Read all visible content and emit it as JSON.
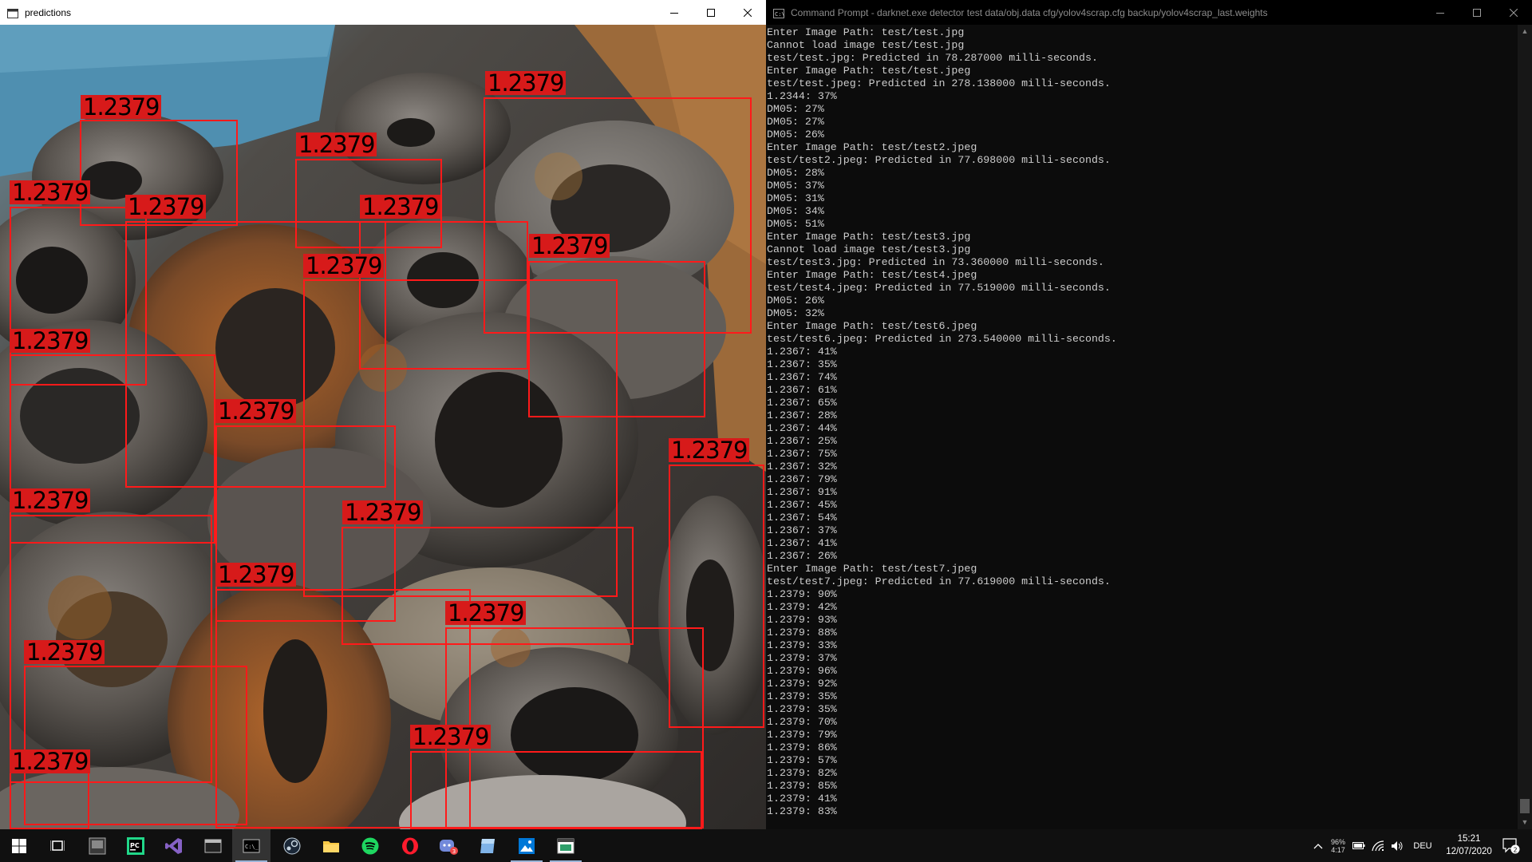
{
  "predictions_window": {
    "title": "predictions",
    "label_text": "1.2379"
  },
  "cmd_window": {
    "title": "Command Prompt - darknet.exe  detector test data/obj.data cfg/yolov4scrap.cfg backup/yolov4scrap_last.weights",
    "lines": [
      "Enter Image Path: test/test.jpg",
      "Cannot load image test/test.jpg",
      "test/test.jpg: Predicted in 78.287000 milli-seconds.",
      "Enter Image Path: test/test.jpeg",
      "test/test.jpeg: Predicted in 278.138000 milli-seconds.",
      "1.2344: 37%",
      "DM05: 27%",
      "DM05: 27%",
      "DM05: 26%",
      "Enter Image Path: test/test2.jpeg",
      "test/test2.jpeg: Predicted in 77.698000 milli-seconds.",
      "DM05: 28%",
      "DM05: 37%",
      "DM05: 31%",
      "DM05: 34%",
      "DM05: 51%",
      "Enter Image Path: test/test3.jpg",
      "Cannot load image test/test3.jpg",
      "test/test3.jpg: Predicted in 73.360000 milli-seconds.",
      "Enter Image Path: test/test4.jpeg",
      "test/test4.jpeg: Predicted in 77.519000 milli-seconds.",
      "DM05: 26%",
      "DM05: 32%",
      "Enter Image Path: test/test6.jpeg",
      "test/test6.jpeg: Predicted in 273.540000 milli-seconds.",
      "1.2367: 41%",
      "1.2367: 35%",
      "1.2367: 74%",
      "1.2367: 61%",
      "1.2367: 65%",
      "1.2367: 28%",
      "1.2367: 44%",
      "1.2367: 25%",
      "1.2367: 75%",
      "1.2367: 32%",
      "1.2367: 79%",
      "1.2367: 91%",
      "1.2367: 45%",
      "1.2367: 54%",
      "1.2367: 37%",
      "1.2367: 41%",
      "1.2367: 26%",
      "Enter Image Path: test/test7.jpeg",
      "test/test7.jpeg: Predicted in 77.619000 milli-seconds.",
      "1.2379: 90%",
      "1.2379: 42%",
      "1.2379: 93%",
      "1.2379: 88%",
      "1.2379: 33%",
      "1.2379: 37%",
      "1.2379: 96%",
      "1.2379: 92%",
      "1.2379: 35%",
      "1.2379: 35%",
      "1.2379: 70%",
      "1.2379: 79%",
      "1.2379: 86%",
      "1.2379: 57%",
      "1.2379: 82%",
      "1.2379: 85%",
      "1.2379: 41%",
      "1.2379: 83%"
    ]
  },
  "taskbar": {
    "battery_percent": "96%",
    "battery_time": "4:17",
    "language": "DEU",
    "time": "15:21",
    "date": "12/07/2020",
    "notification_count": "2",
    "discord_badge": "3"
  },
  "colors": {
    "detection_box": "#ff1a1a",
    "detection_label_bg": "#d71a1a",
    "console_bg": "#0c0c0c",
    "console_text": "#cccccc",
    "taskbar_bg": "#101010"
  }
}
